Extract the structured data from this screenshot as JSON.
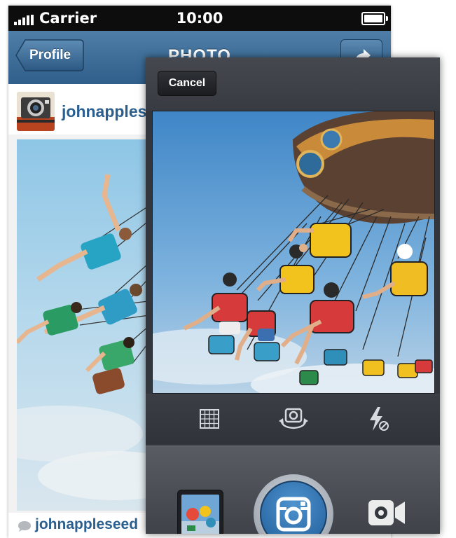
{
  "status_bar": {
    "carrier": "Carrier",
    "time": "10:00"
  },
  "nav": {
    "back_label": "Profile",
    "title": "PHOTO"
  },
  "post": {
    "username": "johnapplesc",
    "caption_username": "johnappleseed"
  },
  "camera": {
    "cancel_label": "Cancel"
  },
  "icons": {
    "grid": "grid-icon",
    "flip": "camera-flip-icon",
    "flash": "flash-off-icon",
    "shutter": "instagram-camera-icon",
    "video": "video-camera-icon",
    "share": "share-arrow-icon",
    "comment": "comment-icon"
  },
  "colors": {
    "nav_blue": "#3a6a96",
    "username_blue": "#2a5f8f",
    "camera_dark": "#33373d",
    "shutter_blue": "#2f74b5"
  }
}
